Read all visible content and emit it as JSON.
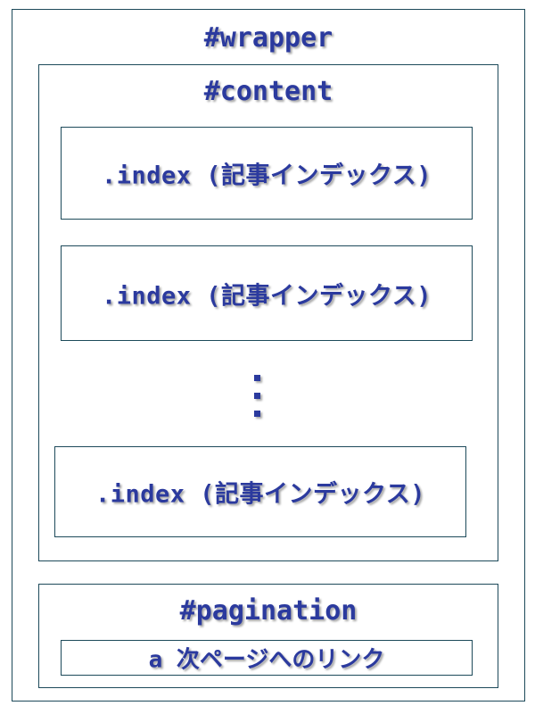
{
  "wrapper": {
    "label": "#wrapper"
  },
  "content": {
    "label": "#content",
    "index_items": [
      {
        "label": ".index (記事インデックス)"
      },
      {
        "label": ".index (記事インデックス)"
      },
      {
        "label": ".index (記事インデックス)"
      }
    ],
    "ellipsis": "⋮"
  },
  "pagination": {
    "label": "#pagination",
    "link_label": "a 次ページへのリンク"
  },
  "colors": {
    "border": "#1d4a5a",
    "text": "#2b3a9e"
  }
}
